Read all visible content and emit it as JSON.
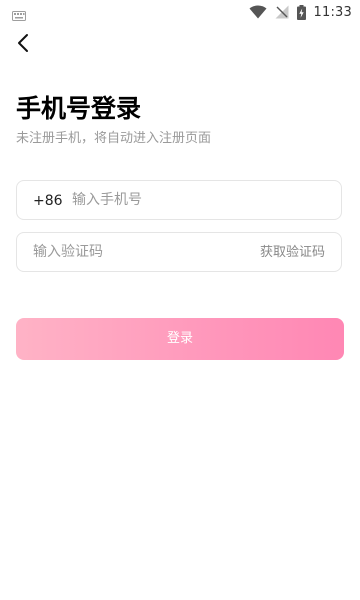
{
  "status_bar": {
    "time": "11:33",
    "icons": [
      "keyboard-icon",
      "wifi-icon",
      "signal-icon",
      "battery-charging-icon"
    ]
  },
  "header": {
    "back_icon": "chevron-left-icon"
  },
  "main": {
    "title": "手机号登录",
    "subtitle": "未注册手机，将自动进入注册页面"
  },
  "phone_field": {
    "country_code": "+86",
    "value": "",
    "placeholder": "输入手机号"
  },
  "code_field": {
    "value": "",
    "placeholder": "输入验证码",
    "get_code_label": "获取验证码"
  },
  "login_button": {
    "label": "登录"
  },
  "colors": {
    "accent_start": "#ffb3c6",
    "accent_end": "#ff87b4",
    "subtitle_text": "#9a9a9a",
    "field_border": "#e5e5e5"
  }
}
